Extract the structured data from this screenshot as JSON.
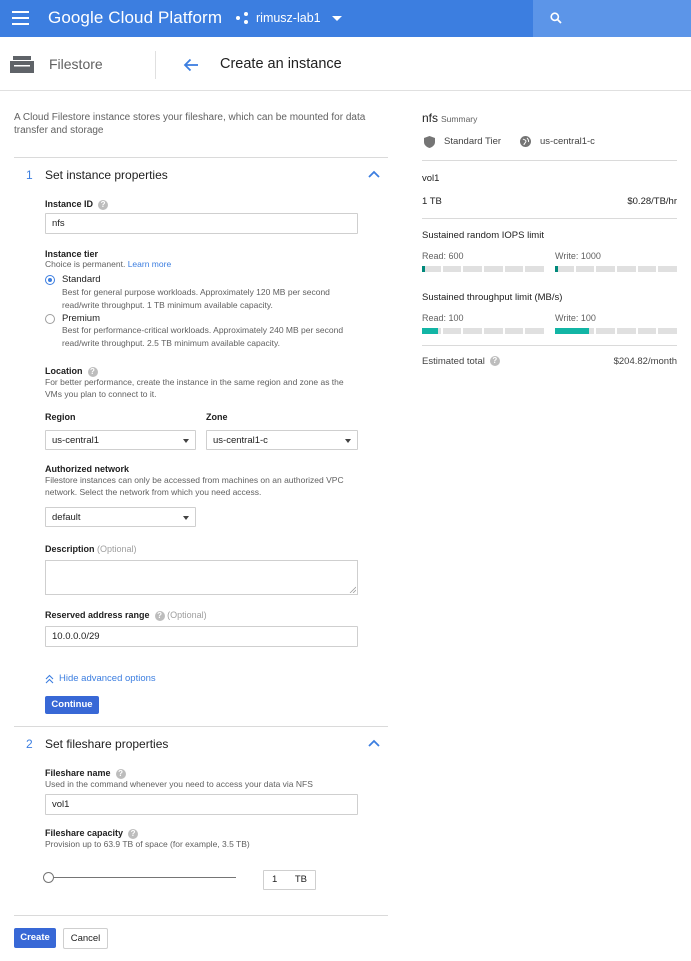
{
  "topbar": {
    "brand": "Google Cloud Platform",
    "project": "rimusz-lab1"
  },
  "subhead": {
    "product": "Filestore",
    "title": "Create an instance"
  },
  "intro": "A Cloud Filestore instance stores your fileshare, which can be mounted for data transfer and storage",
  "step1": {
    "num": "1",
    "title": "Set instance properties",
    "instance_id_label": "Instance ID",
    "instance_id_value": "nfs",
    "tier_label": "Instance tier",
    "tier_hint": "Choice is permanent.",
    "learn_more": "Learn more",
    "tiers": [
      {
        "label": "Standard",
        "desc": "Best for general purpose workloads. Approximately 120 MB per second read/write throughput. 1 TB minimum available capacity.",
        "checked": true
      },
      {
        "label": "Premium",
        "desc": "Best for performance-critical workloads. Approximately 240 MB per second read/write throughput. 2.5 TB minimum available capacity.",
        "checked": false
      }
    ],
    "location_label": "Location",
    "location_hint": "For better performance, create the instance in the same region and zone as the VMs you plan to connect to it.",
    "region_label": "Region",
    "region_value": "us-central1",
    "zone_label": "Zone",
    "zone_value": "us-central1-c",
    "network_label": "Authorized network",
    "network_hint": "Filestore instances can only be accessed from machines on an authorized VPC network. Select the network from which you need access.",
    "network_value": "default",
    "description_label": "Description",
    "description_optional": "(Optional)",
    "reserved_label": "Reserved address range",
    "reserved_optional": "(Optional)",
    "reserved_value": "10.0.0.0/29",
    "advanced_link": "Hide advanced options",
    "continue": "Continue"
  },
  "step2": {
    "num": "2",
    "title": "Set fileshare properties",
    "name_label": "Fileshare name",
    "name_hint": "Used in the command whenever you need to access your data via NFS",
    "name_value": "vol1",
    "capacity_label": "Fileshare capacity",
    "capacity_hint": "Provision up to 63.9 TB of space (for example, 3.5 TB)",
    "capacity_value": "1",
    "capacity_unit": "TB"
  },
  "actions": {
    "create": "Create",
    "cancel": "Cancel"
  },
  "summary": {
    "name": "nfs",
    "label": "Summary",
    "tier": "Standard Tier",
    "zone": "us-central1-c",
    "share_name": "vol1",
    "size": "1 TB",
    "price": "$0.28/TB/hr",
    "iops_title": "Sustained random IOPS limit",
    "iops_read": "Read: 600",
    "iops_write": "Write: 1000",
    "iops_read_fraction": 0.02,
    "iops_write_fraction": 0.02,
    "throughput_title": "Sustained throughput limit (MB/s)",
    "throughput_read": "Read: 100",
    "throughput_write": "Write: 100",
    "throughput_read_fraction": 0.13,
    "throughput_write_fraction": 0.28,
    "total_label": "Estimated total",
    "total_value": "$204.82/month"
  },
  "colors": {
    "topbar": "#3c7ee0",
    "accent": "#3c7ee0",
    "meter_fill": "#12b5a5"
  }
}
